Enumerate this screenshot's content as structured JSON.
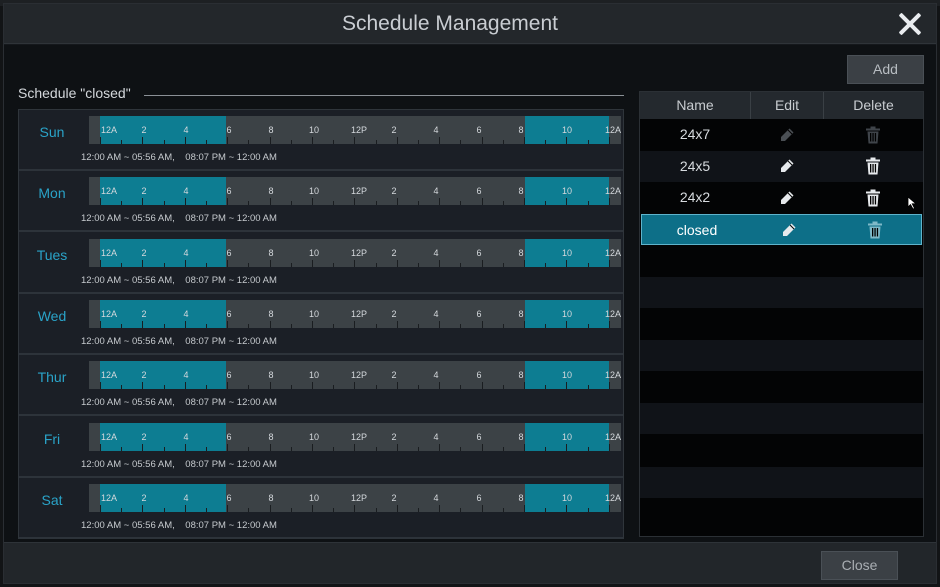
{
  "dialog": {
    "title": "Schedule Management",
    "close_icon": "close-icon"
  },
  "toolbar": {
    "add_label": "Add"
  },
  "schedule": {
    "label": "Schedule \"closed\"",
    "hour_labels": [
      "12A",
      "2",
      "4",
      "6",
      "8",
      "10",
      "12P",
      "2",
      "4",
      "6",
      "8",
      "10",
      "12A"
    ],
    "active_ranges": [
      {
        "start": "12:00 AM",
        "end": "05:56 AM"
      },
      {
        "start": "08:07 PM",
        "end": "12:00 AM"
      }
    ],
    "days": [
      {
        "name": "Sun",
        "range_text": "12:00 AM ~ 05:56 AM,    08:07 PM ~ 12:00 AM"
      },
      {
        "name": "Mon",
        "range_text": "12:00 AM ~ 05:56 AM,    08:07 PM ~ 12:00 AM"
      },
      {
        "name": "Tues",
        "range_text": "12:00 AM ~ 05:56 AM,    08:07 PM ~ 12:00 AM"
      },
      {
        "name": "Wed",
        "range_text": "12:00 AM ~ 05:56 AM,    08:07 PM ~ 12:00 AM"
      },
      {
        "name": "Thur",
        "range_text": "12:00 AM ~ 05:56 AM,    08:07 PM ~ 12:00 AM"
      },
      {
        "name": "Fri",
        "range_text": "12:00 AM ~ 05:56 AM,    08:07 PM ~ 12:00 AM"
      },
      {
        "name": "Sat",
        "range_text": "12:00 AM ~ 05:56 AM,    08:07 PM ~ 12:00 AM"
      }
    ]
  },
  "list": {
    "headers": {
      "name": "Name",
      "edit": "Edit",
      "delete": "Delete"
    },
    "items": [
      {
        "name": "24x7",
        "editable": false,
        "deletable": false,
        "selected": false
      },
      {
        "name": "24x5",
        "editable": true,
        "deletable": true,
        "selected": false
      },
      {
        "name": "24x2",
        "editable": true,
        "deletable": true,
        "selected": false
      },
      {
        "name": "closed",
        "editable": true,
        "deletable": false,
        "selected": true
      }
    ],
    "edit_icon": "pencil-icon",
    "delete_icon": "trash-icon"
  },
  "footer": {
    "close_label": "Close"
  },
  "colors": {
    "accent": "#0d7d92",
    "day_label": "#2aa3c8",
    "selected_row": "#0d6f88"
  }
}
